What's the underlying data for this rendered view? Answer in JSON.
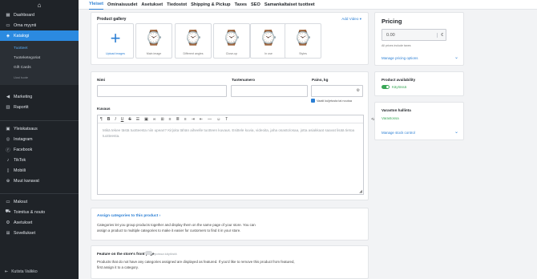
{
  "sidebar": {
    "items": [
      {
        "icon": "home-icon",
        "label": "Dashboard"
      },
      {
        "icon": "store-icon",
        "label": "Oma myynti"
      },
      {
        "icon": "tag-icon",
        "label": "Katalogi"
      }
    ],
    "subitems": [
      "Tuotteet",
      "Tuoteketegoriat",
      "Gift Cards",
      "Uusi tuote"
    ],
    "items2": [
      {
        "icon": "megaphone-icon",
        "label": "Marketing"
      },
      {
        "icon": "chart-icon",
        "label": "Raportit"
      }
    ],
    "items3": [
      {
        "icon": "overview-icon",
        "label": "Yleiskatsaus"
      },
      {
        "icon": "instagram-icon",
        "label": "Instagram"
      },
      {
        "icon": "facebook-icon",
        "label": "Facebook"
      },
      {
        "icon": "tiktok-icon",
        "label": "TikTok"
      },
      {
        "icon": "mobile-icon",
        "label": "Mobiili"
      },
      {
        "icon": "plus-circle-icon",
        "label": "Muut kanavat"
      }
    ],
    "items4": [
      {
        "icon": "payment-icon",
        "label": "Maksut"
      },
      {
        "icon": "truck-icon",
        "label": "Toimitus & nouto"
      },
      {
        "icon": "gear-icon",
        "label": "Asetukset"
      },
      {
        "icon": "apps-icon",
        "label": "Sovellukset"
      }
    ],
    "collapse": "Kutista Valikko"
  },
  "tabs": [
    "Yleiset",
    "Ominaisuudet",
    "Asetukset",
    "Tiedostot",
    "Shipping & Pickup",
    "Taxes",
    "SEO",
    "Samankaltaiset tuotteet"
  ],
  "gallery": {
    "title": "Product gallery",
    "add_video": "Add Video",
    "tiles": [
      "Upload images",
      "Main image",
      "Different angles",
      "Close-up",
      "In use",
      "Styles"
    ]
  },
  "fields": {
    "name_label": "Nimi",
    "sku_label": "Tuotenumero",
    "weight_label": "Paino, kg",
    "weight_unit": "⚙",
    "requires_shipping": "Vaatii kuljetusta tai noutoa",
    "desc_label": "Kuvaus",
    "desc_placeholder": "Mikä tekee tästä tuotteesta niin upean? Kirjoita tähän aiheelle tuotteen kuvaus. Esittele kuvia, videoita, jaha osasto/osaa, jotta asiakkaat saavat lisää tietoa tuotteesta."
  },
  "categories": {
    "link": "Assign categories to this product",
    "text": "Categories let you group products together and display them on the same page of your store. You can assign a product to multiple categories to make it easier for customers to find it in your store."
  },
  "featured": {
    "title": "Feature on the store's front page",
    "toggle_label": "poissa käytöstä",
    "text": "Products that do not have any categories assigned are displayed as featured. If you'd like to remove this product from featured, first assign it to a category."
  },
  "pricing": {
    "title": "Pricing",
    "value": "0.00",
    "currency": "€",
    "note": "All prices include taxes",
    "manage": "Manage pricing options"
  },
  "availability": {
    "title": "Product availability",
    "status": "Käytössä"
  },
  "stock": {
    "title": "Varaston hallinta",
    "status": "Varastossa",
    "manage": "Manage stock control"
  },
  "colors": {
    "accent": "#2b7fd4",
    "sidebar": "#1f2328",
    "active": "#2b8ae0",
    "toggle": "#3aa757"
  }
}
